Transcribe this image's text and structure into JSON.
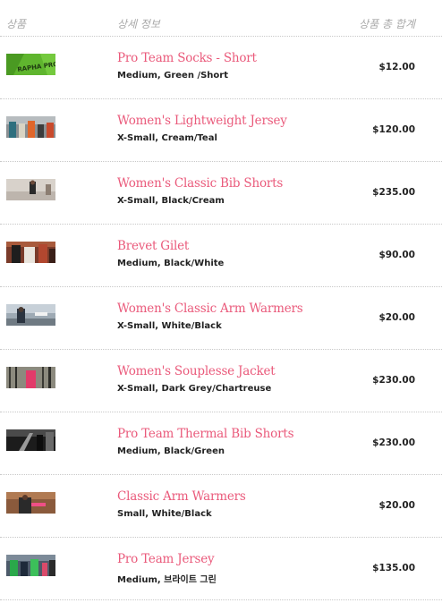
{
  "header": {
    "product": "상품",
    "detail": "상세 정보",
    "total": "상품 총 합계"
  },
  "items": [
    {
      "name": "Pro Team Socks - Short",
      "variant": "Medium, Green /Short",
      "price": "$12.00",
      "thumb_text": "RAPHA PRO"
    },
    {
      "name": "Women's Lightweight Jersey",
      "variant": "X-Small, Cream/Teal",
      "price": "$120.00"
    },
    {
      "name": "Women's Classic Bib Shorts",
      "variant": "X-Small, Black/Cream",
      "price": "$235.00"
    },
    {
      "name": "Brevet Gilet",
      "variant": "Medium, Black/White",
      "price": "$90.00"
    },
    {
      "name": "Women's Classic Arm Warmers",
      "variant": "X-Small, White/Black",
      "price": "$20.00"
    },
    {
      "name": "Women's Souplesse Jacket",
      "variant": "X-Small, Dark Grey/Chartreuse",
      "price": "$230.00"
    },
    {
      "name": "Pro Team Thermal Bib Shorts",
      "variant": "Medium, Black/Green",
      "price": "$230.00"
    },
    {
      "name": "Classic Arm Warmers",
      "variant": "Small, White/Black",
      "price": "$20.00"
    },
    {
      "name": "Pro Team Jersey",
      "variant": "Medium, 브라이트 그린",
      "price": "$135.00"
    }
  ],
  "colors": {
    "product_name": "#ea5a7b",
    "header_text": "#a9a9a9",
    "divider": "#c8c8c8"
  }
}
